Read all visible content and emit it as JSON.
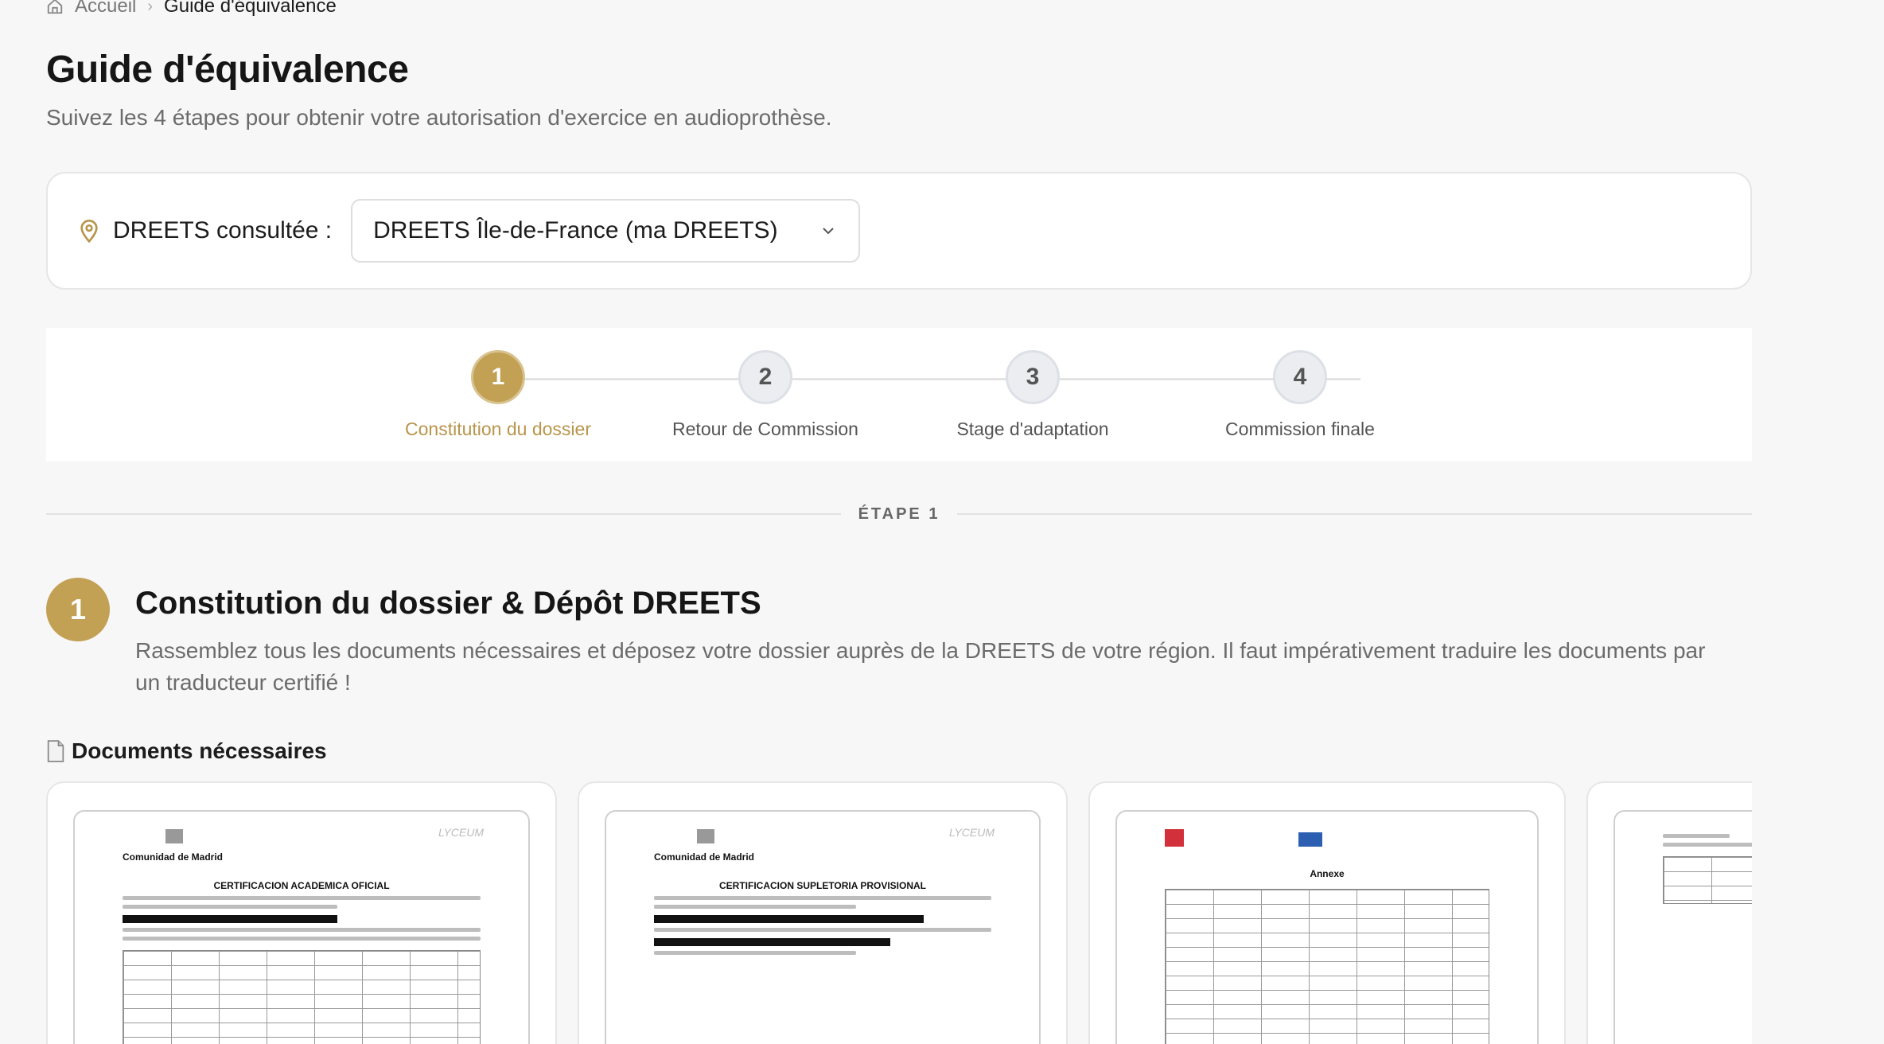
{
  "breadcrumb": {
    "home": "Accueil",
    "current": "Guide d'équivalence"
  },
  "header": {
    "title": "Guide d'équivalence",
    "subtitle": "Suivez les 4 étapes pour obtenir votre autorisation d'exercice en audioprothèse."
  },
  "dreets": {
    "label": "DREETS consultée :",
    "selected": "DREETS Île-de-France (ma DREETS)"
  },
  "steps": [
    {
      "number": "1",
      "label": "Constitution du dossier",
      "active": true
    },
    {
      "number": "2",
      "label": "Retour de Commission",
      "active": false
    },
    {
      "number": "3",
      "label": "Stage d'adaptation",
      "active": false
    },
    {
      "number": "4",
      "label": "Commission finale",
      "active": false
    }
  ],
  "divider_label": "ÉTAPE 1",
  "section": {
    "number": "1",
    "title": "Constitution du dossier & Dépôt DREETS",
    "description": "Rassemblez tous les documents nécessaires et déposez votre dossier auprès de la DREETS de votre région. Il faut impérativement traduire les documents par un traducteur certifié !"
  },
  "documents": {
    "heading": "Documents nécessaires",
    "cards": [
      {
        "org": "Comunidad de Madrid",
        "title": "CERTIFICACION ACADEMICA OFICIAL",
        "logo": "LYCEUM"
      },
      {
        "org": "Comunidad de Madrid",
        "title": "CERTIFICACION SUPLETORIA PROVISIONAL",
        "logo": "LYCEUM"
      },
      {
        "org": "",
        "title": "Annexe",
        "logo": ""
      },
      {
        "org": "",
        "title": "",
        "logo": ""
      }
    ]
  },
  "colors": {
    "accent": "#c2a054",
    "accent_text": "#b8954b"
  }
}
